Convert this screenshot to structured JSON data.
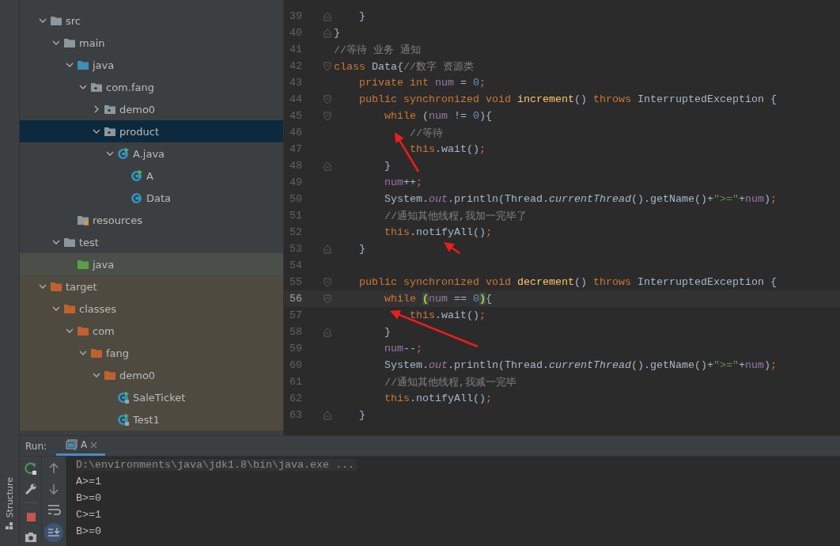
{
  "side_stripe": {
    "label": "Structure"
  },
  "project_tree": [
    {
      "label": "src",
      "kind": "folder",
      "expanded": true,
      "selected": false,
      "hovered": false,
      "children": [
        {
          "label": "main",
          "kind": "folder",
          "expanded": true,
          "selected": false,
          "hovered": false,
          "children": [
            {
              "label": "java",
              "kind": "source-folder",
              "expanded": true,
              "selected": false,
              "hovered": false,
              "children": [
                {
                  "label": "com.fang",
                  "kind": "package",
                  "expanded": true,
                  "selected": false,
                  "hovered": false,
                  "children": [
                    {
                      "label": "demo0",
                      "kind": "package",
                      "expanded": false,
                      "selected": false,
                      "hovered": false
                    },
                    {
                      "label": "product",
                      "kind": "package",
                      "expanded": true,
                      "selected": true,
                      "hovered": false,
                      "children": [
                        {
                          "label": "A.java",
                          "kind": "runnable-class",
                          "expanded": true,
                          "selected": false,
                          "hovered": false,
                          "children": [
                            {
                              "label": "A",
                              "kind": "runnable-class",
                              "selected": false,
                              "hovered": false
                            },
                            {
                              "label": "Data",
                              "kind": "class",
                              "selected": false,
                              "hovered": false
                            }
                          ]
                        }
                      ]
                    }
                  ]
                }
              ]
            },
            {
              "label": "resources",
              "kind": "resources-folder",
              "selected": false,
              "hovered": false
            }
          ]
        },
        {
          "label": "test",
          "kind": "folder",
          "expanded": true,
          "selected": false,
          "hovered": false,
          "children": [
            {
              "label": "java",
              "kind": "test-folder",
              "selected": false,
              "hovered": true
            }
          ]
        }
      ]
    },
    {
      "label": "target",
      "kind": "excluded-folder",
      "expanded": true,
      "selected": false,
      "hovered": false,
      "children": [
        {
          "label": "classes",
          "kind": "excluded-folder",
          "expanded": true,
          "selected": false,
          "children": [
            {
              "label": "com",
              "kind": "excluded-folder",
              "expanded": true,
              "selected": false,
              "children": [
                {
                  "label": "fang",
                  "kind": "excluded-folder",
                  "expanded": true,
                  "selected": false,
                  "children": [
                    {
                      "label": "demo0",
                      "kind": "excluded-folder",
                      "expanded": true,
                      "selected": false,
                      "children": [
                        {
                          "label": "SaleTicket",
                          "kind": "compiled-class",
                          "selected": false
                        },
                        {
                          "label": "Test1",
                          "kind": "compiled-class",
                          "selected": false
                        }
                      ]
                    }
                  ]
                }
              ]
            }
          ]
        }
      ]
    }
  ],
  "editor": {
    "lines": [
      {
        "number": "39",
        "current": false,
        "kind": "fold-end",
        "tokens": [
          {
            "text": "    }",
            "kind": "plain"
          }
        ]
      },
      {
        "number": "40",
        "current": false,
        "kind": "fold-end",
        "tokens": [
          {
            "text": "}",
            "kind": "plain"
          }
        ]
      },
      {
        "number": "41",
        "current": false,
        "kind": "plain",
        "tokens": [
          {
            "text": "//等待 业务 通知",
            "kind": "comment"
          }
        ]
      },
      {
        "number": "42",
        "current": false,
        "kind": "fold-start",
        "tokens": [
          {
            "text": "class ",
            "kind": "keyword"
          },
          {
            "text": "Data{",
            "kind": "plain"
          },
          {
            "text": "//数字 资源类",
            "kind": "comment"
          }
        ]
      },
      {
        "number": "43",
        "current": false,
        "kind": "plain",
        "tokens": [
          {
            "text": "    private int ",
            "kind": "keyword"
          },
          {
            "text": "num",
            "kind": "field"
          },
          {
            "text": " = ",
            "kind": "plain"
          },
          {
            "text": "0",
            "kind": "number"
          },
          {
            "text": ";",
            "kind": "keyword"
          }
        ]
      },
      {
        "number": "44",
        "current": false,
        "kind": "fold-start",
        "tokens": [
          {
            "text": "    public synchronized void ",
            "kind": "keyword"
          },
          {
            "text": "increment",
            "kind": "method"
          },
          {
            "text": "() ",
            "kind": "plain"
          },
          {
            "text": "throws ",
            "kind": "keyword"
          },
          {
            "text": "InterruptedException {",
            "kind": "plain"
          }
        ]
      },
      {
        "number": "45",
        "current": false,
        "kind": "fold-start",
        "tokens": [
          {
            "text": "        while ",
            "kind": "keyword"
          },
          {
            "text": "(",
            "kind": "plain"
          },
          {
            "text": "num",
            "kind": "field"
          },
          {
            "text": " != ",
            "kind": "plain"
          },
          {
            "text": "0",
            "kind": "number"
          },
          {
            "text": "){",
            "kind": "plain"
          }
        ]
      },
      {
        "number": "46",
        "current": false,
        "kind": "plain",
        "tokens": [
          {
            "text": "            //等待",
            "kind": "comment"
          }
        ]
      },
      {
        "number": "47",
        "current": false,
        "kind": "plain",
        "tokens": [
          {
            "text": "            this",
            "kind": "keyword"
          },
          {
            "text": ".wait()",
            "kind": "plain"
          },
          {
            "text": ";",
            "kind": "keyword"
          }
        ]
      },
      {
        "number": "48",
        "current": false,
        "kind": "fold-end",
        "tokens": [
          {
            "text": "        }",
            "kind": "plain"
          }
        ]
      },
      {
        "number": "49",
        "current": false,
        "kind": "plain",
        "tokens": [
          {
            "text": "        num",
            "kind": "field"
          },
          {
            "text": "++",
            "kind": "plain"
          },
          {
            "text": ";",
            "kind": "keyword"
          }
        ]
      },
      {
        "number": "50",
        "current": false,
        "kind": "plain",
        "tokens": [
          {
            "text": "        System.",
            "kind": "plain"
          },
          {
            "text": "out",
            "kind": "static-field"
          },
          {
            "text": ".println(Thread.",
            "kind": "plain"
          },
          {
            "text": "currentThread",
            "kind": "static-method"
          },
          {
            "text": "().getName()+",
            "kind": "plain"
          },
          {
            "text": "\">=\"",
            "kind": "string"
          },
          {
            "text": "+",
            "kind": "plain"
          },
          {
            "text": "num",
            "kind": "field"
          },
          {
            "text": ")",
            "kind": "plain"
          },
          {
            "text": ";",
            "kind": "keyword"
          }
        ]
      },
      {
        "number": "51",
        "current": false,
        "kind": "plain",
        "tokens": [
          {
            "text": "        //通知其他线程,我加一完毕了",
            "kind": "comment"
          }
        ]
      },
      {
        "number": "52",
        "current": false,
        "kind": "plain",
        "tokens": [
          {
            "text": "        this",
            "kind": "keyword"
          },
          {
            "text": ".notifyAll()",
            "kind": "plain"
          },
          {
            "text": ";",
            "kind": "keyword"
          }
        ]
      },
      {
        "number": "53",
        "current": false,
        "kind": "fold-end",
        "tokens": [
          {
            "text": "    }",
            "kind": "plain"
          }
        ]
      },
      {
        "number": "54",
        "current": false,
        "kind": "plain"
      },
      {
        "number": "55",
        "current": false,
        "kind": "fold-start",
        "tokens": [
          {
            "text": "    public synchronized void ",
            "kind": "keyword"
          },
          {
            "text": "decrement",
            "kind": "method"
          },
          {
            "text": "() ",
            "kind": "plain"
          },
          {
            "text": "throws ",
            "kind": "keyword"
          },
          {
            "text": "InterruptedException {",
            "kind": "plain"
          }
        ]
      },
      {
        "number": "56",
        "current": true,
        "kind": "fold-start",
        "tokens": [
          {
            "text": "        while ",
            "kind": "keyword"
          },
          {
            "text": "(",
            "kind": "bracket-match"
          },
          {
            "text": "num",
            "kind": "field"
          },
          {
            "text": " == ",
            "kind": "plain"
          },
          {
            "text": "0",
            "kind": "number"
          },
          {
            "text": ")",
            "kind": "bracket-match"
          },
          {
            "text": "{",
            "kind": "plain"
          }
        ]
      },
      {
        "number": "57",
        "current": false,
        "kind": "plain",
        "tokens": [
          {
            "text": "            this",
            "kind": "keyword"
          },
          {
            "text": ".wait()",
            "kind": "plain"
          },
          {
            "text": ";",
            "kind": "keyword"
          }
        ]
      },
      {
        "number": "58",
        "current": false,
        "kind": "fold-end",
        "tokens": [
          {
            "text": "        }",
            "kind": "plain"
          }
        ]
      },
      {
        "number": "59",
        "current": false,
        "kind": "plain",
        "tokens": [
          {
            "text": "        num",
            "kind": "field"
          },
          {
            "text": "--",
            "kind": "plain"
          },
          {
            "text": ";",
            "kind": "keyword"
          }
        ]
      },
      {
        "number": "60",
        "current": false,
        "kind": "plain",
        "tokens": [
          {
            "text": "        System.",
            "kind": "plain"
          },
          {
            "text": "out",
            "kind": "static-field"
          },
          {
            "text": ".println(Thread.",
            "kind": "plain"
          },
          {
            "text": "currentThread",
            "kind": "static-method"
          },
          {
            "text": "().getName()+",
            "kind": "plain"
          },
          {
            "text": "\">=\"",
            "kind": "string"
          },
          {
            "text": "+",
            "kind": "plain"
          },
          {
            "text": "num",
            "kind": "field"
          },
          {
            "text": ")",
            "kind": "plain"
          },
          {
            "text": ";",
            "kind": "keyword"
          }
        ]
      },
      {
        "number": "61",
        "current": false,
        "kind": "plain",
        "tokens": [
          {
            "text": "        //通知其他线程,我减一完毕",
            "kind": "comment"
          }
        ]
      },
      {
        "number": "62",
        "current": false,
        "kind": "plain",
        "tokens": [
          {
            "text": "        this",
            "kind": "keyword"
          },
          {
            "text": ".notifyAll()",
            "kind": "plain"
          },
          {
            "text": ";",
            "kind": "keyword"
          }
        ]
      },
      {
        "number": "63",
        "current": false,
        "kind": "fold-end",
        "tokens": [
          {
            "text": "    }",
            "kind": "plain"
          }
        ]
      }
    ]
  },
  "run_panel": {
    "label": "Run:",
    "tabs": [
      {
        "label": "A",
        "selected": true
      }
    ],
    "console": [
      {
        "text": "D:\\environments\\java\\jdk1.8\\bin\\java.exe ...",
        "kind": "command"
      },
      {
        "text": "A>=1",
        "kind": "output"
      },
      {
        "text": "B>=0",
        "kind": "output"
      },
      {
        "text": "C>=1",
        "kind": "output"
      },
      {
        "text": "B>=0",
        "kind": "output"
      }
    ]
  }
}
